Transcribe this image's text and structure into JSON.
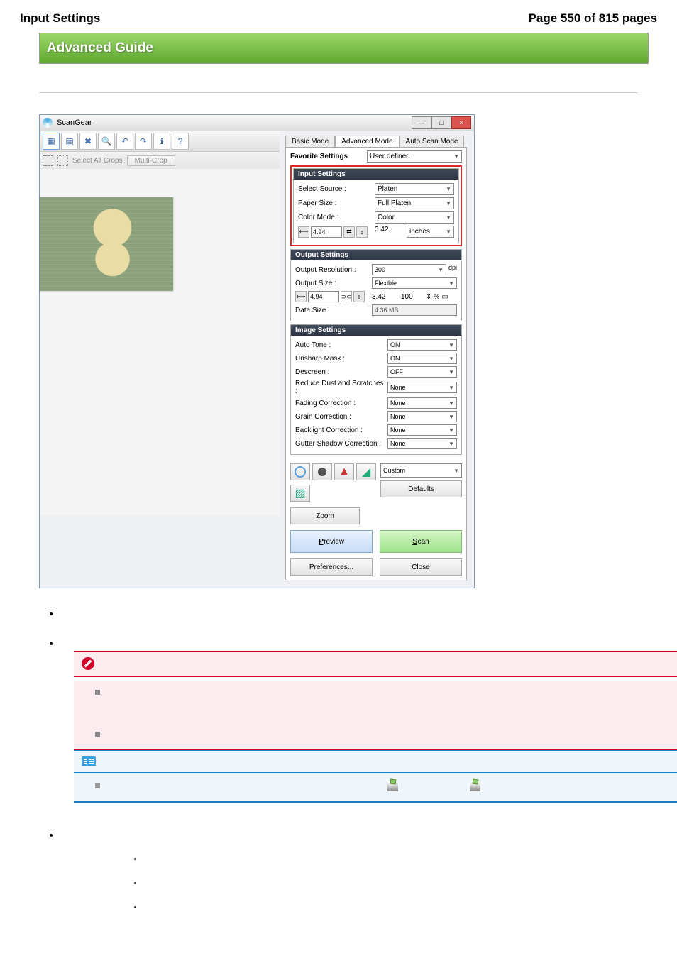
{
  "header": {
    "left": "Input Settings",
    "right": "Page 550 of 815 pages"
  },
  "banner": "Advanced Guide",
  "app": {
    "title": "ScanGear",
    "wmin": "—",
    "wmax": "□",
    "wclose": "×",
    "toolbar": {
      "selectAll": "Select All Crops",
      "multi": "Multi-Crop"
    },
    "tabs": {
      "basic": "Basic Mode",
      "adv": "Advanced Mode",
      "auto": "Auto Scan Mode"
    },
    "fav": {
      "label": "Favorite Settings",
      "value": "User defined"
    },
    "input": {
      "head": "Input Settings",
      "src": {
        "l": "Select Source :",
        "v": "Platen"
      },
      "paper": {
        "l": "Paper Size :",
        "v": "Full Platen"
      },
      "cmode": {
        "l": "Color Mode :",
        "v": "Color"
      },
      "w": "4.94",
      "wu": "",
      "h": "3.42",
      "u": "inches"
    },
    "output": {
      "head": "Output Settings",
      "res": {
        "l": "Output Resolution :",
        "v": "300",
        "u": "dpi"
      },
      "size": {
        "l": "Output Size :",
        "v": "Flexible"
      },
      "w": "4.94",
      "h": "3.42",
      "pct": "100",
      "data": {
        "l": "Data Size :",
        "v": "4.36 MB"
      }
    },
    "image": {
      "head": "Image Settings",
      "items": [
        {
          "l": "Auto Tone :",
          "v": "ON"
        },
        {
          "l": "Unsharp Mask :",
          "v": "ON"
        },
        {
          "l": "Descreen :",
          "v": "OFF"
        },
        {
          "l": "Reduce Dust and Scratches :",
          "v": "None"
        },
        {
          "l": "Fading Correction :",
          "v": "None"
        },
        {
          "l": "Grain Correction :",
          "v": "None"
        },
        {
          "l": "Backlight Correction :",
          "v": "None"
        },
        {
          "l": "Gutter Shadow Correction :",
          "v": "None"
        }
      ]
    },
    "custom": "Custom",
    "defaults": "Defaults",
    "zoom": "Zoom",
    "preview": "Preview",
    "scan": "Scan",
    "prefs": "Preferences...",
    "close": "Close"
  },
  "note": {
    "important": "",
    "noteLabel": ""
  }
}
